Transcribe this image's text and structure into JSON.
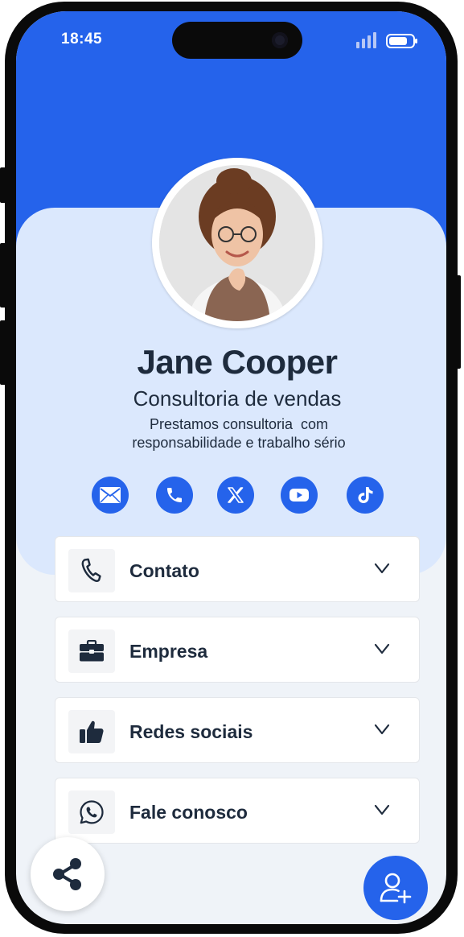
{
  "status_bar": {
    "time": "18:45",
    "signal_icon": "signal-icon",
    "battery_icon": "battery-icon"
  },
  "profile": {
    "name": "Jane Cooper",
    "title": "Consultoria de vendas",
    "description_line1": "Prestamos consultoria  com",
    "description_line2": "responsabilidade e trabalho sério",
    "avatar_icon": "avatar-photo"
  },
  "social_links": [
    {
      "icon": "email-icon"
    },
    {
      "icon": "phone-icon"
    },
    {
      "icon": "x-twitter-icon"
    },
    {
      "icon": "youtube-icon"
    },
    {
      "icon": "tiktok-icon"
    }
  ],
  "sections": [
    {
      "label": "Contato",
      "icon": "phone-handset-icon"
    },
    {
      "label": "Empresa",
      "icon": "briefcase-icon"
    },
    {
      "label": "Redes sociais",
      "icon": "thumbs-up-icon"
    },
    {
      "label": "Fale conosco",
      "icon": "whatsapp-icon"
    }
  ],
  "actions": {
    "share_icon": "share-icon",
    "add_contact_icon": "add-user-icon"
  },
  "colors": {
    "primary": "#2563eb",
    "hero_bg": "#dbe8fd",
    "page_bg": "#eff3f8",
    "text": "#1e2b3d"
  }
}
